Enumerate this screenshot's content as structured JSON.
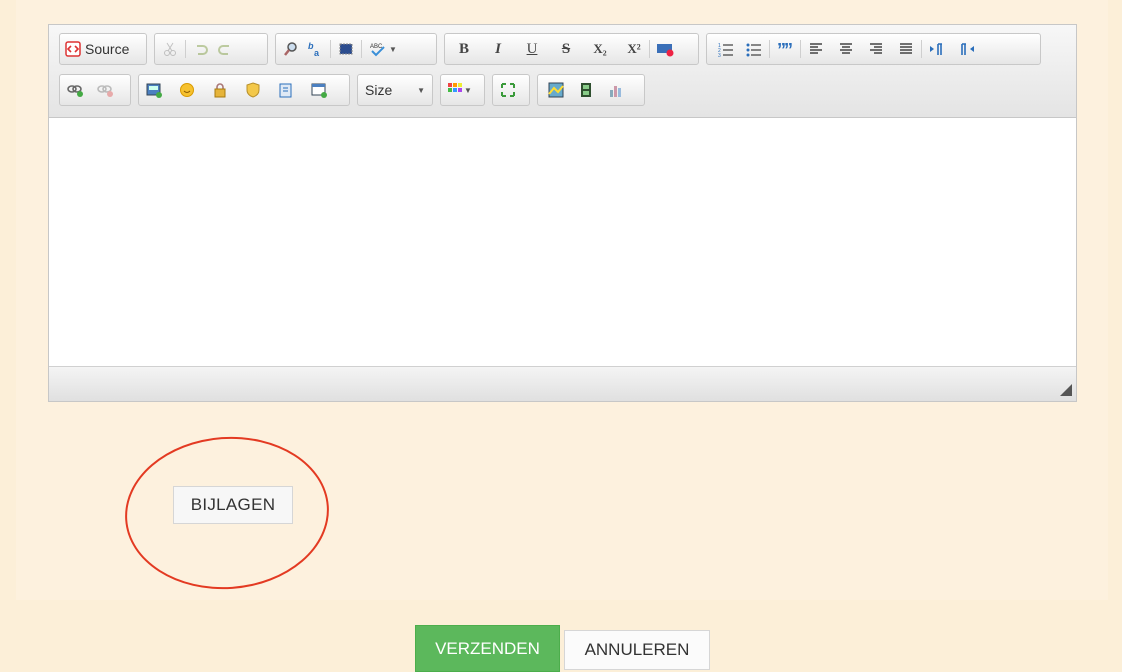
{
  "editor": {
    "toolbar": {
      "source_label": "Source",
      "bold": "B",
      "italic": "I",
      "underline": "U",
      "strike": "S",
      "subscript": "X₂",
      "superscript": "X²",
      "size_label": "Size",
      "icons": [
        "source-icon",
        "cut-icon",
        "undo-icon",
        "redo-icon",
        "find-icon",
        "replace-icon",
        "select-all-icon",
        "spellcheck-icon",
        "bold-icon",
        "italic-icon",
        "underline-icon",
        "strikethrough-icon",
        "subscript-icon",
        "superscript-icon",
        "remove-format-icon",
        "numbered-list-icon",
        "bulleted-list-icon",
        "blockquote-icon",
        "align-left-icon",
        "align-center-icon",
        "align-right-icon",
        "justify-icon",
        "ltr-icon",
        "rtl-icon",
        "link-icon",
        "unlink-icon",
        "image-icon",
        "smiley-icon",
        "lock-icon",
        "shield-icon",
        "paste-icon",
        "iframe-icon",
        "color-grid-icon",
        "maximize-icon",
        "chart-image-icon",
        "video-icon",
        "bar-chart-icon"
      ]
    },
    "content": ""
  },
  "attachments_button": "BIJLAGEN",
  "actions": {
    "submit": "VERZENDEN",
    "cancel": "ANNULEREN"
  },
  "colors": {
    "background": "#fcefd8",
    "submit": "#5cb85c",
    "highlight": "#e33a22"
  }
}
